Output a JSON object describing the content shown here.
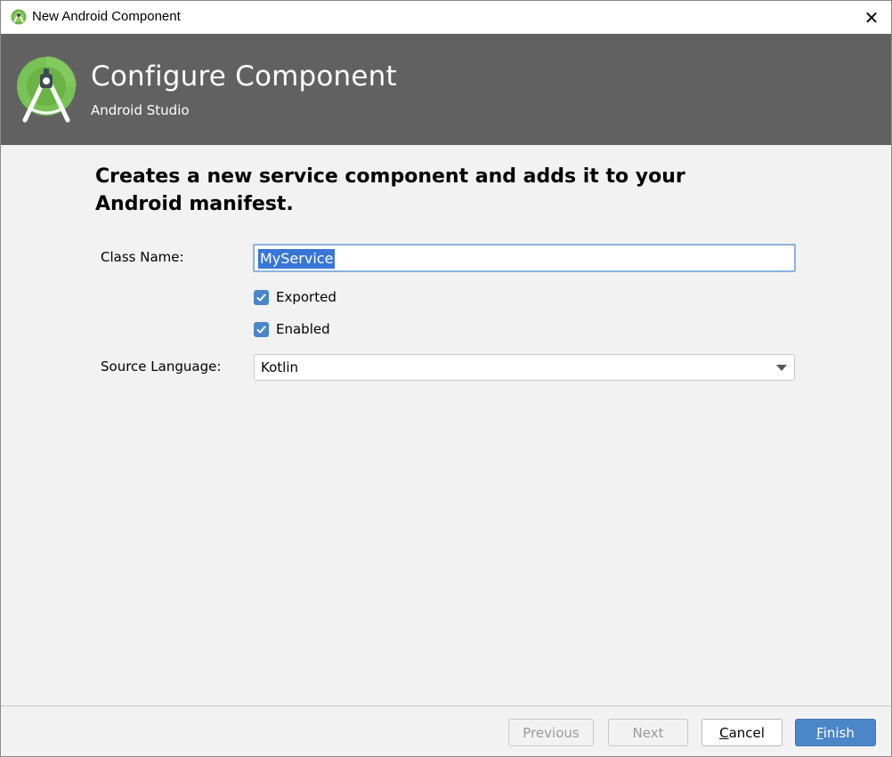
{
  "window": {
    "title": "New Android Component",
    "icon": "android-studio-icon",
    "close_glyph": "✕"
  },
  "header": {
    "title": "Configure Component",
    "subtitle": "Android Studio",
    "logo": "android-studio-logo",
    "background": "#616161"
  },
  "description": "Creates a new service component and adds it to your Android manifest.",
  "form": {
    "class_name_label": "Class Name:",
    "class_name_value": "MyService",
    "exported_label": "Exported",
    "exported_checked": true,
    "enabled_label": "Enabled",
    "enabled_checked": true,
    "source_language_label": "Source Language:",
    "source_language_value": "Kotlin"
  },
  "buttons": {
    "previous": "Previous",
    "next": "Next",
    "cancel_mnemonic": "C",
    "cancel_rest": "ancel",
    "finish_mnemonic": "F",
    "finish_rest": "inish"
  },
  "colors": {
    "accent": "#4a86c8",
    "selection": "#3875d7"
  }
}
